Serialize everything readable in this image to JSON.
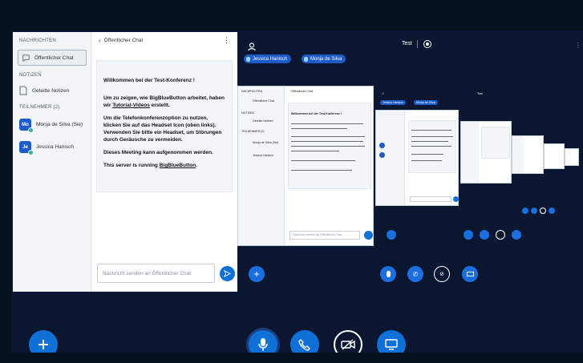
{
  "userlist": {
    "messages_title": "NACHRICHTEN",
    "public_chat_label": "Öffentlicher Chat",
    "notes_title": "NOTIZEN",
    "shared_notes_label": "Geteilte Notizen",
    "participants_title": "TEILNEHMER (2)",
    "users": [
      {
        "initials": "Mo",
        "name": "Monja de Silva (Sie)",
        "color": "#1d5cc7"
      },
      {
        "initials": "Je",
        "name": "Jessica Hanisch",
        "color": "#1d5cc7"
      }
    ]
  },
  "chat": {
    "title": "Öffentlicher Chat",
    "back_icon": "chevron-left-icon",
    "welcome": "Willkommen bei der Test-Konferenz !",
    "p1_pre": "Um zu zeigen, wie BigBlueButton arbeitet, haben wir ",
    "p1_link": "Tutorial-Videos",
    "p1_post": " erstellt.",
    "p2": "Um die Telefonkonferenzoption zu nutzen, klicken Sie auf das Headset Icon (oben links). Verwenden Sie bitte ein Headset, um Störungen durch Geräusche zu vermeiden.",
    "p3": "Dieses Meeting kann aufgenommen werden.",
    "p4_pre": "This server is running ",
    "p4_link": "BigBlueButton",
    "p4_post": ".",
    "input_placeholder": "Nachricht senden an Öffentlicher Chat"
  },
  "presentation": {
    "title": "Test",
    "talkers": [
      "Jessica Hanisch",
      "Monja de Silva"
    ]
  },
  "mini": {
    "chat_title": "Öffentlicher Chat",
    "messages_title": "NACHRICHTEN",
    "public_chat_label": "Öffentlicher Chat",
    "notes_title": "NOTIZEN",
    "shared_notes_label": "Geteilte Notizen",
    "participants_title": "TEILNEHMER (2)",
    "user1": "Monja de Silva (Sie)",
    "user2": "Jessica Hanisch",
    "input_placeholder": "Nachricht senden an Öffentlicher Chat",
    "welcome": "Willkommen bei der Test-Konferenz !",
    "talkers": [
      "Jessica Hanisch",
      "Monja de Silva"
    ],
    "title": "Test"
  },
  "colors": {
    "accent": "#0f70d7",
    "background": "#0b1630"
  }
}
